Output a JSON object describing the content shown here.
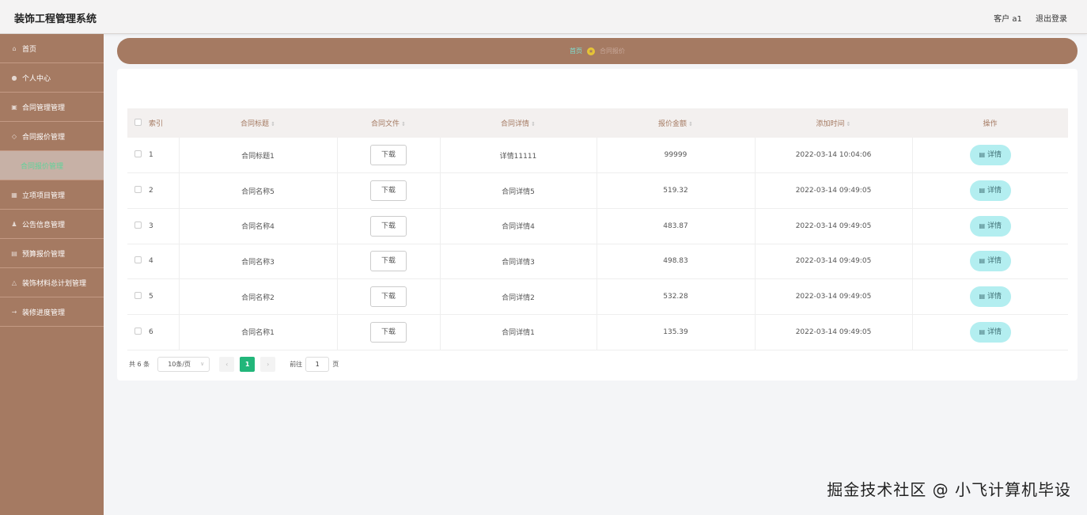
{
  "app": {
    "title": "装饰工程管理系统"
  },
  "header": {
    "user_label": "客户 a1",
    "logout_label": "退出登录"
  },
  "sidebar": {
    "items": [
      {
        "label": "首页",
        "icon": "home-icon"
      },
      {
        "label": "个人中心",
        "icon": "user-icon"
      },
      {
        "label": "合同管理管理",
        "icon": "contract-icon"
      },
      {
        "label": "合同报价管理",
        "icon": "quote-icon"
      },
      {
        "label": "合同报价管理",
        "icon": "sub",
        "active": true
      },
      {
        "label": "立项项目管理",
        "icon": "project-icon"
      },
      {
        "label": "公告信息管理",
        "icon": "notice-icon"
      },
      {
        "label": "预算报价管理",
        "icon": "budget-icon"
      },
      {
        "label": "装饰材料总计划管理",
        "icon": "material-icon"
      },
      {
        "label": "装修进度管理",
        "icon": "progress-icon"
      }
    ]
  },
  "breadcrumb": {
    "home": "首页",
    "current": "合同报价"
  },
  "table": {
    "headers": [
      "索引",
      "合同标题",
      "合同文件",
      "合同详情",
      "报价金额",
      "添加时间",
      "操作"
    ],
    "download_label": "下载",
    "detail_label": "详情",
    "rows": [
      {
        "index": "1",
        "title": "合同标题1",
        "detail": "详情11111",
        "amount": "99999",
        "time": "2022-03-14 10:04:06"
      },
      {
        "index": "2",
        "title": "合同名称5",
        "detail": "合同详情5",
        "amount": "519.32",
        "time": "2022-03-14 09:49:05"
      },
      {
        "index": "3",
        "title": "合同名称4",
        "detail": "合同详情4",
        "amount": "483.87",
        "time": "2022-03-14 09:49:05"
      },
      {
        "index": "4",
        "title": "合同名称3",
        "detail": "合同详情3",
        "amount": "498.83",
        "time": "2022-03-14 09:49:05"
      },
      {
        "index": "5",
        "title": "合同名称2",
        "detail": "合同详情2",
        "amount": "532.28",
        "time": "2022-03-14 09:49:05"
      },
      {
        "index": "6",
        "title": "合同名称1",
        "detail": "合同详情1",
        "amount": "135.39",
        "time": "2022-03-14 09:49:05"
      }
    ]
  },
  "pagination": {
    "total_label": "共 6 条",
    "page_size": "10条/页",
    "current_page": "1",
    "goto_label": "前往",
    "goto_value": "1",
    "page_suffix": "页"
  },
  "watermark": "掘金技术社区 @ 小飞计算机毕设",
  "colors": {
    "sidebar": "#a57a62",
    "accent": "#22b67a",
    "detail_button": "#b3eef0"
  }
}
